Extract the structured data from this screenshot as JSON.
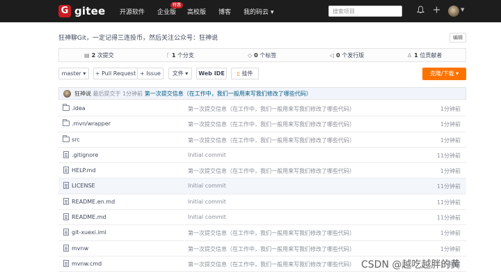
{
  "header": {
    "logo_mark": "G",
    "logo_text": "gitee",
    "nav": [
      {
        "label": "开源软件"
      },
      {
        "label": "企业版"
      },
      {
        "label": "高校版"
      },
      {
        "label": "博客"
      },
      {
        "label": "我的码云 ▾"
      }
    ],
    "nav_badge": "特惠",
    "search_placeholder": "搜索项目",
    "bell_icon": "bell-icon",
    "plus_icon": "plus-icon"
  },
  "repo": {
    "description": "狂神聊Git，一定记得三连投币，然后关注公众号：狂神说",
    "edit_label": "编辑"
  },
  "stats": [
    {
      "icon": "commit-icon",
      "count": "2",
      "label": "次提交"
    },
    {
      "icon": "branch-icon",
      "count": "1",
      "label": "个分支"
    },
    {
      "icon": "tag-icon",
      "count": "0",
      "label": "个标签"
    },
    {
      "icon": "release-icon",
      "count": "0",
      "label": "个发行版"
    },
    {
      "icon": "contributor-icon",
      "count": "1",
      "label": "位贡献者"
    }
  ],
  "toolbar": {
    "branch": "master ▾",
    "pull_request": "+ Pull Request",
    "issue": "+ Issue",
    "file": "文件 ▾",
    "web_ide": "Web IDE",
    "widget": "挂件",
    "clone": "克隆/下载 ▾"
  },
  "latest_commit": {
    "author": "狂神说",
    "time": "最后提交于 1分钟前",
    "message": "第一次提交信息（在工作中，我们一般用来写我们修改了哪些代码）"
  },
  "files": [
    {
      "type": "folder",
      "name": ".idea",
      "message": "第一次提交信息（在工作中，我们一般用来写我们修改了哪些代码）",
      "time": "1分钟前"
    },
    {
      "type": "folder",
      "name": ".mvn/wrapper",
      "message": "第一次提交信息（在工作中，我们一般用来写我们修改了哪些代码）",
      "time": "1分钟前"
    },
    {
      "type": "folder",
      "name": "src",
      "message": "第一次提交信息（在工作中，我们一般用来写我们修改了哪些代码）",
      "time": "1分钟前"
    },
    {
      "type": "file",
      "name": ".gitignore",
      "message": "Initial commit",
      "time": "11分钟前"
    },
    {
      "type": "file",
      "name": "HELP.md",
      "message": "第一次提交信息（在工作中，我们一般用来写我们修改了哪些代码）",
      "time": "1分钟前"
    },
    {
      "type": "file",
      "name": "LICENSE",
      "message": "Initial commit",
      "time": "11分钟前"
    },
    {
      "type": "file",
      "name": "README.en.md",
      "message": "Initial commit",
      "time": "11分钟前"
    },
    {
      "type": "file",
      "name": "README.md",
      "message": "Initial commit",
      "time": "11分钟前"
    },
    {
      "type": "file",
      "name": "git-xuexi.iml",
      "message": "第一次提交信息（在工作中，我们一般用来写我们修改了哪些代码）",
      "time": "1分钟前"
    },
    {
      "type": "file",
      "name": "mvnw",
      "message": "第一次提交信息（在工作中，我们一般用来写我们修改了哪些代码）",
      "time": "1分钟前"
    },
    {
      "type": "file",
      "name": "mvnw.cmd",
      "message": "第一次提交信息（在工作中，我们一般用来写我们修改了哪些代码）",
      "time": "1分钟前"
    }
  ],
  "watermark": "CSDN @越吃越胖的黄",
  "colors": {
    "topbar": "#1d1d1d",
    "brand": "#c71d23",
    "accent": "#fe7300",
    "link": "#005980"
  }
}
